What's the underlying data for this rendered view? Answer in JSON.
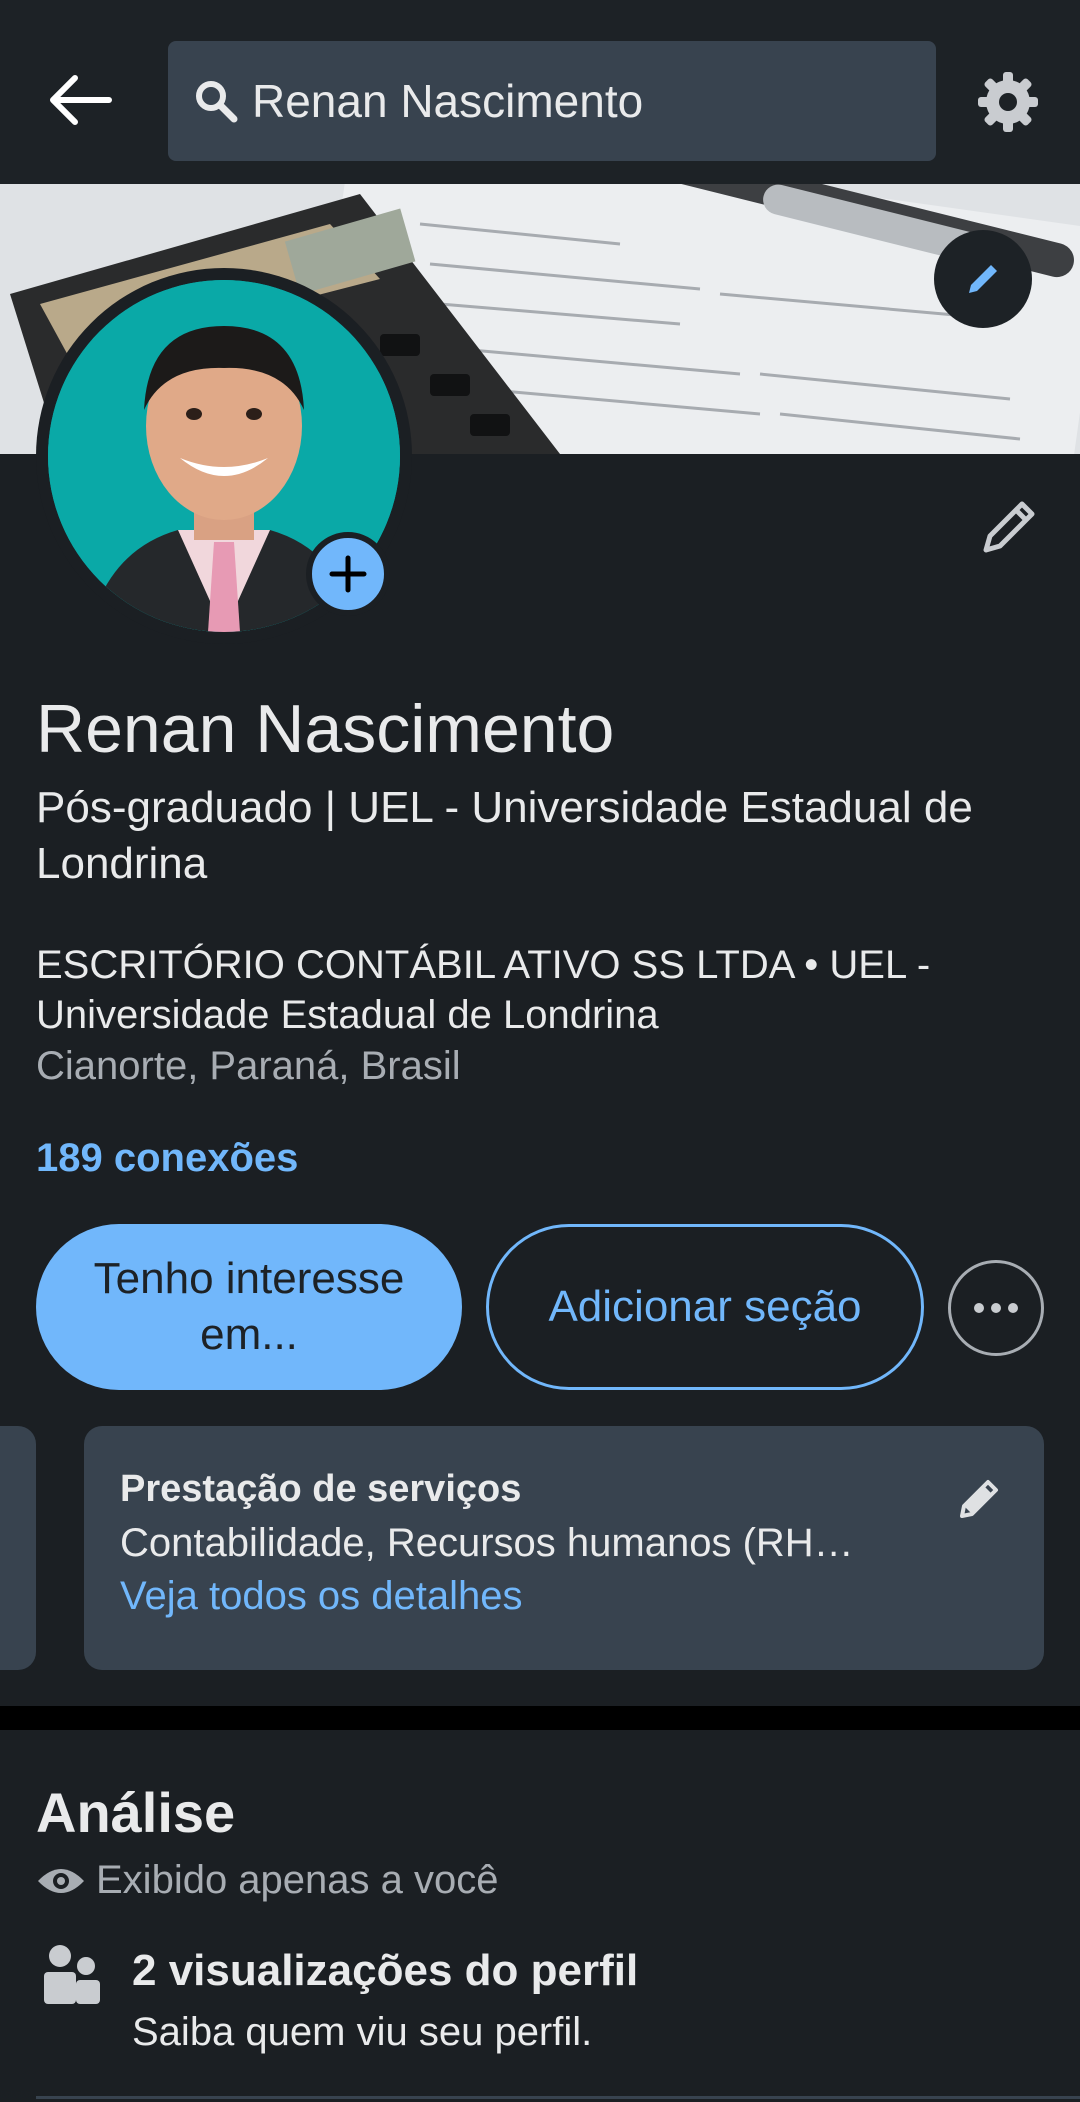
{
  "search": {
    "query": "Renan Nascimento"
  },
  "profile": {
    "name": "Renan Nascimento",
    "headline": "Pós-graduado | UEL - Universidade Estadual de Londrina",
    "company_line": "ESCRITÓRIO CONTÁBIL ATIVO SS LTDA  •  UEL - Universidade Estadual de Londrina",
    "location": "Cianorte, Paraná, Brasil",
    "connections": "189 conexões"
  },
  "actions": {
    "primary_label": "Tenho interesse em...",
    "secondary_label": "Adicionar seção"
  },
  "services_card": {
    "title": "Prestação de serviços",
    "description": "Contabilidade, Recursos humanos (RH…",
    "link": "Veja todos os detalhes"
  },
  "analytics": {
    "title": "Análise",
    "visibility": "Exibido apenas a você",
    "stat_title": "2 visualizações do perfil",
    "stat_subtitle": "Saiba quem viu seu perfil."
  },
  "colors": {
    "background": "#1b1f23",
    "accent": "#71b7fb",
    "card": "#38434f",
    "text_secondary": "#a8adb3"
  },
  "icons": [
    "back-arrow-icon",
    "search-icon",
    "gear-icon",
    "pencil-icon",
    "plus-icon",
    "more-icon",
    "eye-icon",
    "people-icon"
  ]
}
